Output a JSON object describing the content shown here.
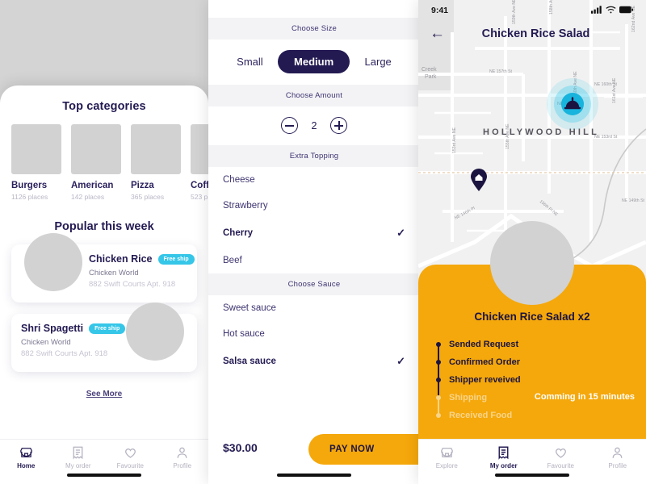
{
  "screen1": {
    "top_categories_title": "Top categories",
    "categories": [
      {
        "name": "Burgers",
        "places": "1126 places"
      },
      {
        "name": "American",
        "places": "142 places"
      },
      {
        "name": "Pizza",
        "places": "365 places"
      },
      {
        "name": "Coff",
        "places": "523 p"
      }
    ],
    "popular_title": "Popular this week",
    "popular": [
      {
        "name": "Chicken Rice",
        "badge": "Free ship",
        "shop": "Chicken World",
        "address": "882 Swift Courts Apt. 918"
      },
      {
        "name": "Shri Spagetti",
        "badge": "Free ship",
        "shop": "Chicken World",
        "address": "882 Swift Courts Apt. 918"
      }
    ],
    "see_more": "See More",
    "tabs": [
      {
        "label": "Home",
        "icon": "store-icon",
        "active": true
      },
      {
        "label": "My order",
        "icon": "receipt-icon",
        "active": false
      },
      {
        "label": "Favourite",
        "icon": "heart-icon",
        "active": false
      },
      {
        "label": "Profile",
        "icon": "person-icon",
        "active": false
      }
    ]
  },
  "screen2": {
    "size_section_title": "Choose Size",
    "sizes": [
      {
        "label": "Small",
        "selected": false
      },
      {
        "label": "Medium",
        "selected": true
      },
      {
        "label": "Large",
        "selected": false
      }
    ],
    "amount_section_title": "Choose Amount",
    "amount_value": "2",
    "decrement_label": "−",
    "increment_label": "+",
    "topping_section_title": "Extra Topping",
    "toppings": [
      {
        "label": "Cheese",
        "selected": false
      },
      {
        "label": "Strawberry",
        "selected": false
      },
      {
        "label": "Cherry",
        "selected": true
      },
      {
        "label": "Beef",
        "selected": false
      }
    ],
    "sauce_section_title": "Choose Sauce",
    "sauces": [
      {
        "label": "Sweet sauce",
        "selected": false
      },
      {
        "label": "Hot sauce",
        "selected": false
      },
      {
        "label": "Salsa sauce",
        "selected": true
      }
    ],
    "check_glyph": "✓",
    "price": "$30.00",
    "pay_label": "PAY NOW",
    "pay_arrow": "→"
  },
  "screen3": {
    "status_time": "9:41",
    "back_glyph": "←",
    "title": "Chicken Rice Salad",
    "map": {
      "neighborhood": "HOLLYWOOD HILL",
      "park_label": "Creek\nPark",
      "street_labels": [
        "NE 157th St",
        "NE 160th St",
        "NE 153rd St",
        "NE 149th St",
        "NE 146th Pl",
        "156th Pl NE",
        "158th Ave NE",
        "159th Ave NE",
        "160th Ave NE",
        "161st Ave NE",
        "162nd Ave NE",
        "155th Ave NE",
        "153rd Ave NE",
        "150th Ave NE"
      ],
      "courier_marker": "food-dome-marker",
      "home_marker": "home-pin-marker"
    },
    "order_title": "Chicken Rice Salad x2",
    "steps": [
      {
        "label": "Sended Request",
        "done": true
      },
      {
        "label": "Confirmed Order",
        "done": true
      },
      {
        "label": "Shipper reveived",
        "done": true
      },
      {
        "label": "Shipping",
        "done": false
      },
      {
        "label": "Received Food",
        "done": false
      }
    ],
    "eta": "Comming in 15 minutes",
    "tabs": [
      {
        "label": "Explore",
        "icon": "store-icon",
        "active": false
      },
      {
        "label": "My order",
        "icon": "receipt-icon",
        "active": true
      },
      {
        "label": "Favourite",
        "icon": "heart-icon",
        "active": false
      },
      {
        "label": "Profile",
        "icon": "person-icon",
        "active": false
      }
    ]
  },
  "colors": {
    "accent_amber": "#f5a80b",
    "accent_cyan": "#35c6e8",
    "navy": "#241a52",
    "muted": "#b4b2c0"
  }
}
